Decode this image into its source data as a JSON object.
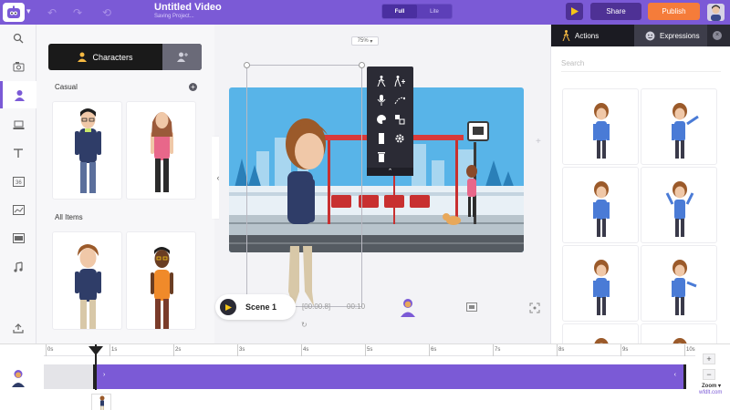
{
  "header": {
    "title": "Untitled Video",
    "subtitle": "Saving Project...",
    "toggle": {
      "options": [
        "Full",
        "Lite"
      ],
      "selected": "Full"
    },
    "share_label": "Share",
    "publish_label": "Publish",
    "accent": "#7b5ad6",
    "publish_color": "#f57c3a"
  },
  "left_nav": {
    "items": [
      {
        "icon": "search-icon",
        "active": false
      },
      {
        "icon": "media-icon",
        "active": false
      },
      {
        "icon": "character-icon",
        "active": true
      },
      {
        "icon": "props-icon",
        "active": false
      },
      {
        "icon": "text-icon",
        "active": false
      },
      {
        "icon": "numbers-icon",
        "active": false
      },
      {
        "icon": "chart-icon",
        "active": false
      },
      {
        "icon": "background-icon",
        "active": false
      },
      {
        "icon": "music-icon",
        "active": false
      },
      {
        "icon": "upload-icon",
        "active": false
      }
    ]
  },
  "character_panel": {
    "tab_label": "Characters",
    "section_casual": "Casual",
    "section_all": "All Items"
  },
  "canvas": {
    "zoom": "75%",
    "scene_label": "Scene 1",
    "time_current": "[00:00.8]",
    "time_total": "00:10"
  },
  "right_panel": {
    "tabs": [
      {
        "label": "Actions",
        "active": true,
        "icon": "walk-icon"
      },
      {
        "label": "Expressions",
        "active": false,
        "icon": "face-icon"
      }
    ],
    "search_placeholder": "Search"
  },
  "timeline": {
    "ticks": [
      "0s",
      "1s",
      "2s",
      "3s",
      "4s",
      "5s",
      "6s",
      "7s",
      "8s",
      "9s",
      "10s"
    ],
    "zoom_label": "Zoom",
    "zoom_in": "+",
    "zoom_out": "−",
    "watermark": "wfdlt.com"
  }
}
